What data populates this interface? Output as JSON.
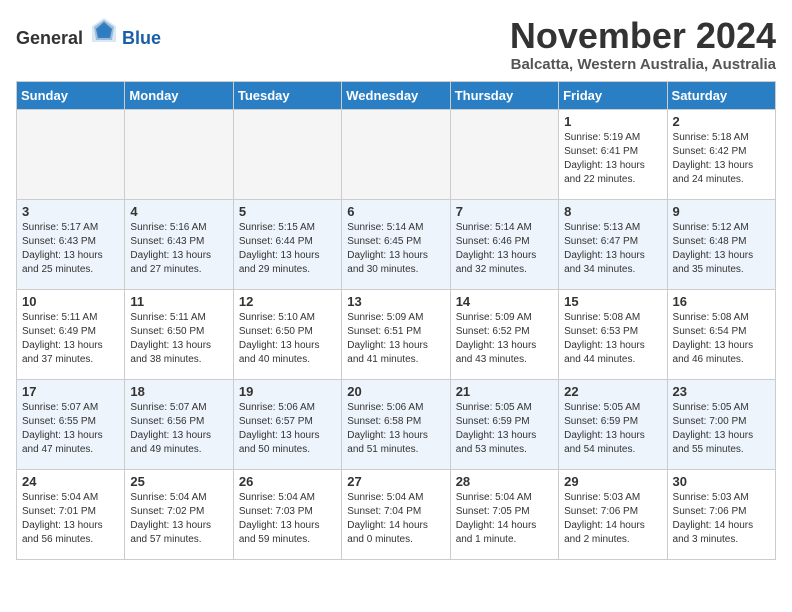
{
  "header": {
    "logo_general": "General",
    "logo_blue": "Blue",
    "title": "November 2024",
    "location": "Balcatta, Western Australia, Australia"
  },
  "days_of_week": [
    "Sunday",
    "Monday",
    "Tuesday",
    "Wednesday",
    "Thursday",
    "Friday",
    "Saturday"
  ],
  "weeks": [
    [
      {
        "day": "",
        "info": ""
      },
      {
        "day": "",
        "info": ""
      },
      {
        "day": "",
        "info": ""
      },
      {
        "day": "",
        "info": ""
      },
      {
        "day": "",
        "info": ""
      },
      {
        "day": "1",
        "info": "Sunrise: 5:19 AM\nSunset: 6:41 PM\nDaylight: 13 hours\nand 22 minutes."
      },
      {
        "day": "2",
        "info": "Sunrise: 5:18 AM\nSunset: 6:42 PM\nDaylight: 13 hours\nand 24 minutes."
      }
    ],
    [
      {
        "day": "3",
        "info": "Sunrise: 5:17 AM\nSunset: 6:43 PM\nDaylight: 13 hours\nand 25 minutes."
      },
      {
        "day": "4",
        "info": "Sunrise: 5:16 AM\nSunset: 6:43 PM\nDaylight: 13 hours\nand 27 minutes."
      },
      {
        "day": "5",
        "info": "Sunrise: 5:15 AM\nSunset: 6:44 PM\nDaylight: 13 hours\nand 29 minutes."
      },
      {
        "day": "6",
        "info": "Sunrise: 5:14 AM\nSunset: 6:45 PM\nDaylight: 13 hours\nand 30 minutes."
      },
      {
        "day": "7",
        "info": "Sunrise: 5:14 AM\nSunset: 6:46 PM\nDaylight: 13 hours\nand 32 minutes."
      },
      {
        "day": "8",
        "info": "Sunrise: 5:13 AM\nSunset: 6:47 PM\nDaylight: 13 hours\nand 34 minutes."
      },
      {
        "day": "9",
        "info": "Sunrise: 5:12 AM\nSunset: 6:48 PM\nDaylight: 13 hours\nand 35 minutes."
      }
    ],
    [
      {
        "day": "10",
        "info": "Sunrise: 5:11 AM\nSunset: 6:49 PM\nDaylight: 13 hours\nand 37 minutes."
      },
      {
        "day": "11",
        "info": "Sunrise: 5:11 AM\nSunset: 6:50 PM\nDaylight: 13 hours\nand 38 minutes."
      },
      {
        "day": "12",
        "info": "Sunrise: 5:10 AM\nSunset: 6:50 PM\nDaylight: 13 hours\nand 40 minutes."
      },
      {
        "day": "13",
        "info": "Sunrise: 5:09 AM\nSunset: 6:51 PM\nDaylight: 13 hours\nand 41 minutes."
      },
      {
        "day": "14",
        "info": "Sunrise: 5:09 AM\nSunset: 6:52 PM\nDaylight: 13 hours\nand 43 minutes."
      },
      {
        "day": "15",
        "info": "Sunrise: 5:08 AM\nSunset: 6:53 PM\nDaylight: 13 hours\nand 44 minutes."
      },
      {
        "day": "16",
        "info": "Sunrise: 5:08 AM\nSunset: 6:54 PM\nDaylight: 13 hours\nand 46 minutes."
      }
    ],
    [
      {
        "day": "17",
        "info": "Sunrise: 5:07 AM\nSunset: 6:55 PM\nDaylight: 13 hours\nand 47 minutes."
      },
      {
        "day": "18",
        "info": "Sunrise: 5:07 AM\nSunset: 6:56 PM\nDaylight: 13 hours\nand 49 minutes."
      },
      {
        "day": "19",
        "info": "Sunrise: 5:06 AM\nSunset: 6:57 PM\nDaylight: 13 hours\nand 50 minutes."
      },
      {
        "day": "20",
        "info": "Sunrise: 5:06 AM\nSunset: 6:58 PM\nDaylight: 13 hours\nand 51 minutes."
      },
      {
        "day": "21",
        "info": "Sunrise: 5:05 AM\nSunset: 6:59 PM\nDaylight: 13 hours\nand 53 minutes."
      },
      {
        "day": "22",
        "info": "Sunrise: 5:05 AM\nSunset: 6:59 PM\nDaylight: 13 hours\nand 54 minutes."
      },
      {
        "day": "23",
        "info": "Sunrise: 5:05 AM\nSunset: 7:00 PM\nDaylight: 13 hours\nand 55 minutes."
      }
    ],
    [
      {
        "day": "24",
        "info": "Sunrise: 5:04 AM\nSunset: 7:01 PM\nDaylight: 13 hours\nand 56 minutes."
      },
      {
        "day": "25",
        "info": "Sunrise: 5:04 AM\nSunset: 7:02 PM\nDaylight: 13 hours\nand 57 minutes."
      },
      {
        "day": "26",
        "info": "Sunrise: 5:04 AM\nSunset: 7:03 PM\nDaylight: 13 hours\nand 59 minutes."
      },
      {
        "day": "27",
        "info": "Sunrise: 5:04 AM\nSunset: 7:04 PM\nDaylight: 14 hours\nand 0 minutes."
      },
      {
        "day": "28",
        "info": "Sunrise: 5:04 AM\nSunset: 7:05 PM\nDaylight: 14 hours\nand 1 minute."
      },
      {
        "day": "29",
        "info": "Sunrise: 5:03 AM\nSunset: 7:06 PM\nDaylight: 14 hours\nand 2 minutes."
      },
      {
        "day": "30",
        "info": "Sunrise: 5:03 AM\nSunset: 7:06 PM\nDaylight: 14 hours\nand 3 minutes."
      }
    ]
  ]
}
